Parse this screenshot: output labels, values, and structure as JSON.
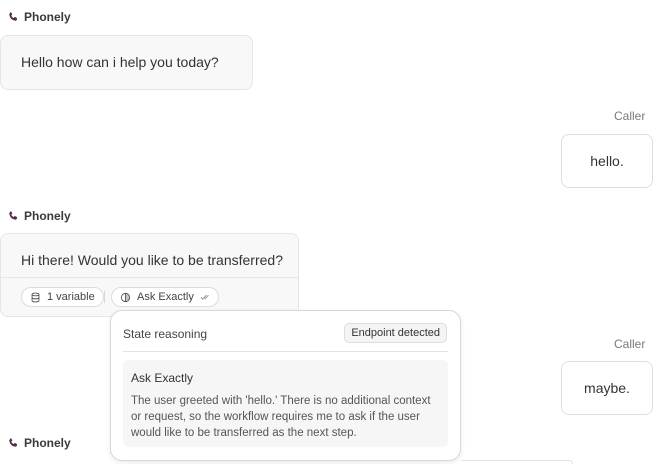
{
  "messages": [
    {
      "speaker": "Phonely",
      "text": "Hello how can i help you today?"
    },
    {
      "speaker": "Caller",
      "text": "hello."
    },
    {
      "speaker": "Phonely",
      "text": "Hi there! Would you like to be transferred?",
      "chips": [
        {
          "label": "1 variable",
          "icon": "database-icon"
        },
        {
          "label": "Ask Exactly",
          "icon": "state-icon",
          "suffix_icon": "double-check-icon"
        }
      ]
    },
    {
      "speaker": "Caller",
      "text": "maybe."
    },
    {
      "speaker": "Phonely"
    }
  ],
  "reasoning_popover": {
    "title": "State reasoning",
    "badge": "Endpoint detected",
    "card_title": "Ask Exactly",
    "card_body": "The user greeted with 'hello.' There is no additional context or request, so the workflow requires me to ask if the user would like to be transferred as the next step."
  },
  "colors": {
    "brand_icon": "#5a2a4a",
    "bubble_bg": "#f8f8f8",
    "border": "#e6e6e6"
  }
}
